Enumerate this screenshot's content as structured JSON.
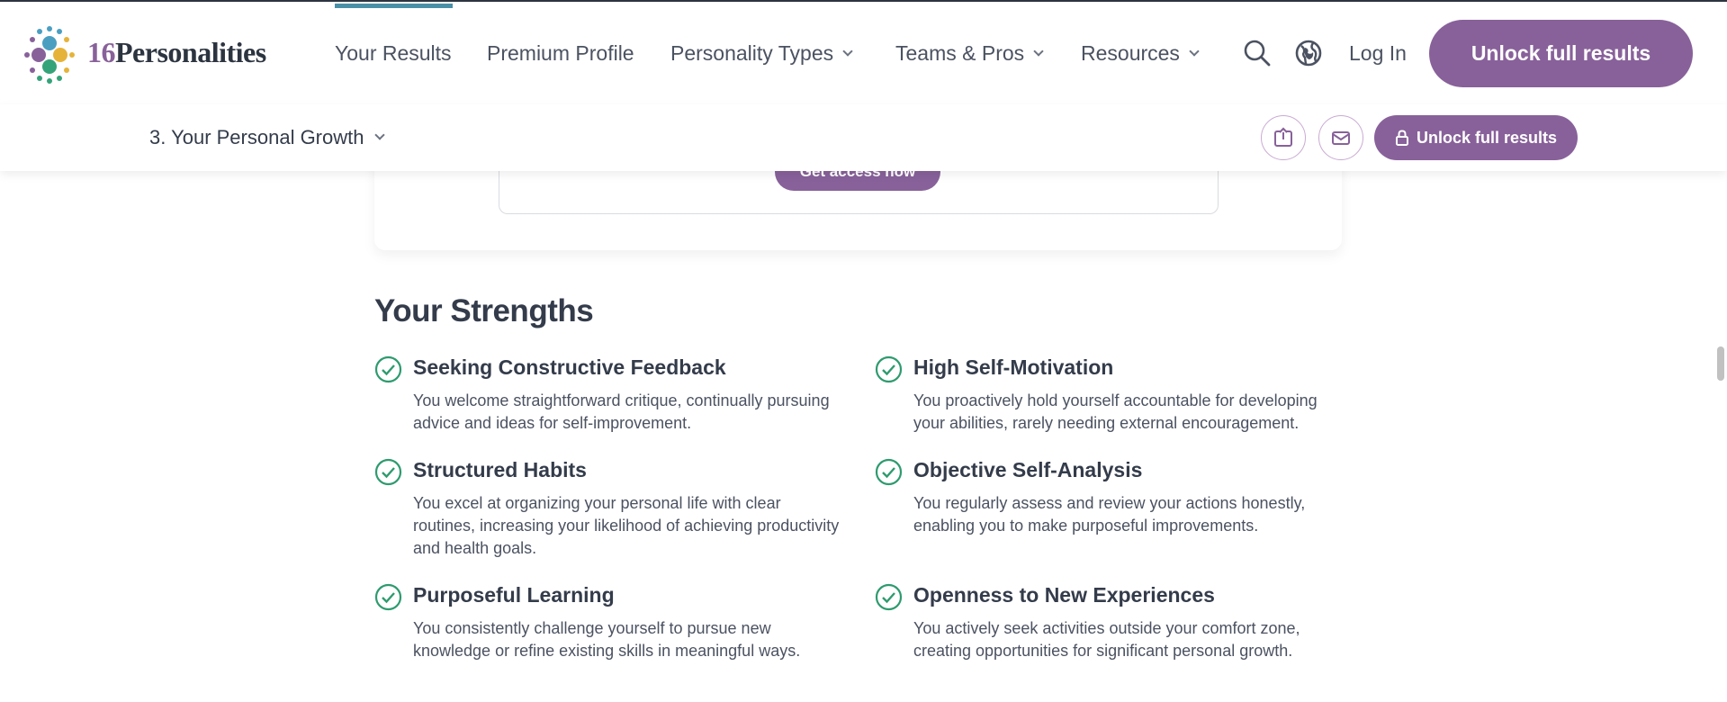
{
  "nav": {
    "brand_number": "16",
    "brand_name": "Personalities",
    "items": [
      {
        "label": "Your Results"
      },
      {
        "label": "Premium Profile"
      },
      {
        "label": "Personality Types"
      },
      {
        "label": "Teams & Pros"
      },
      {
        "label": "Resources"
      }
    ],
    "search_icon": "search-icon",
    "globe_icon": "globe-icon",
    "login_label": "Log In",
    "unlock_label": "Unlock full results"
  },
  "subbar": {
    "section_label": "3. Your Personal Growth",
    "share_icon": "share-icon",
    "email_icon": "mail-icon",
    "unlock_label": "Unlock full results"
  },
  "card": {
    "cta_label": "Get access now"
  },
  "strengths": {
    "heading": "Your Strengths",
    "items": [
      {
        "title": "Seeking Constructive Feedback",
        "desc": "You welcome straightforward critique, continually pursuing advice and ideas for self-improvement."
      },
      {
        "title": "High Self-Motivation",
        "desc": "You proactively hold yourself accountable for developing your abilities, rarely needing external encouragement."
      },
      {
        "title": "Structured Habits",
        "desc": "You excel at organizing your personal life with clear routines, increasing your likelihood of achieving productivity and health goals."
      },
      {
        "title": "Objective Self-Analysis",
        "desc": "You regularly assess and review your actions honestly, enabling you to make purposeful improvements."
      },
      {
        "title": "Purposeful Learning",
        "desc": "You consistently challenge yourself to pursue new knowledge or refine existing skills in meaningful ways."
      },
      {
        "title": "Openness to New Experiences",
        "desc": "You actively seek activities outside your comfort zone, creating opportunities for significant personal growth."
      }
    ]
  },
  "colors": {
    "brand_purple": "#88619a",
    "check_green": "#2e9b6f",
    "text_dark": "#343c4b"
  }
}
